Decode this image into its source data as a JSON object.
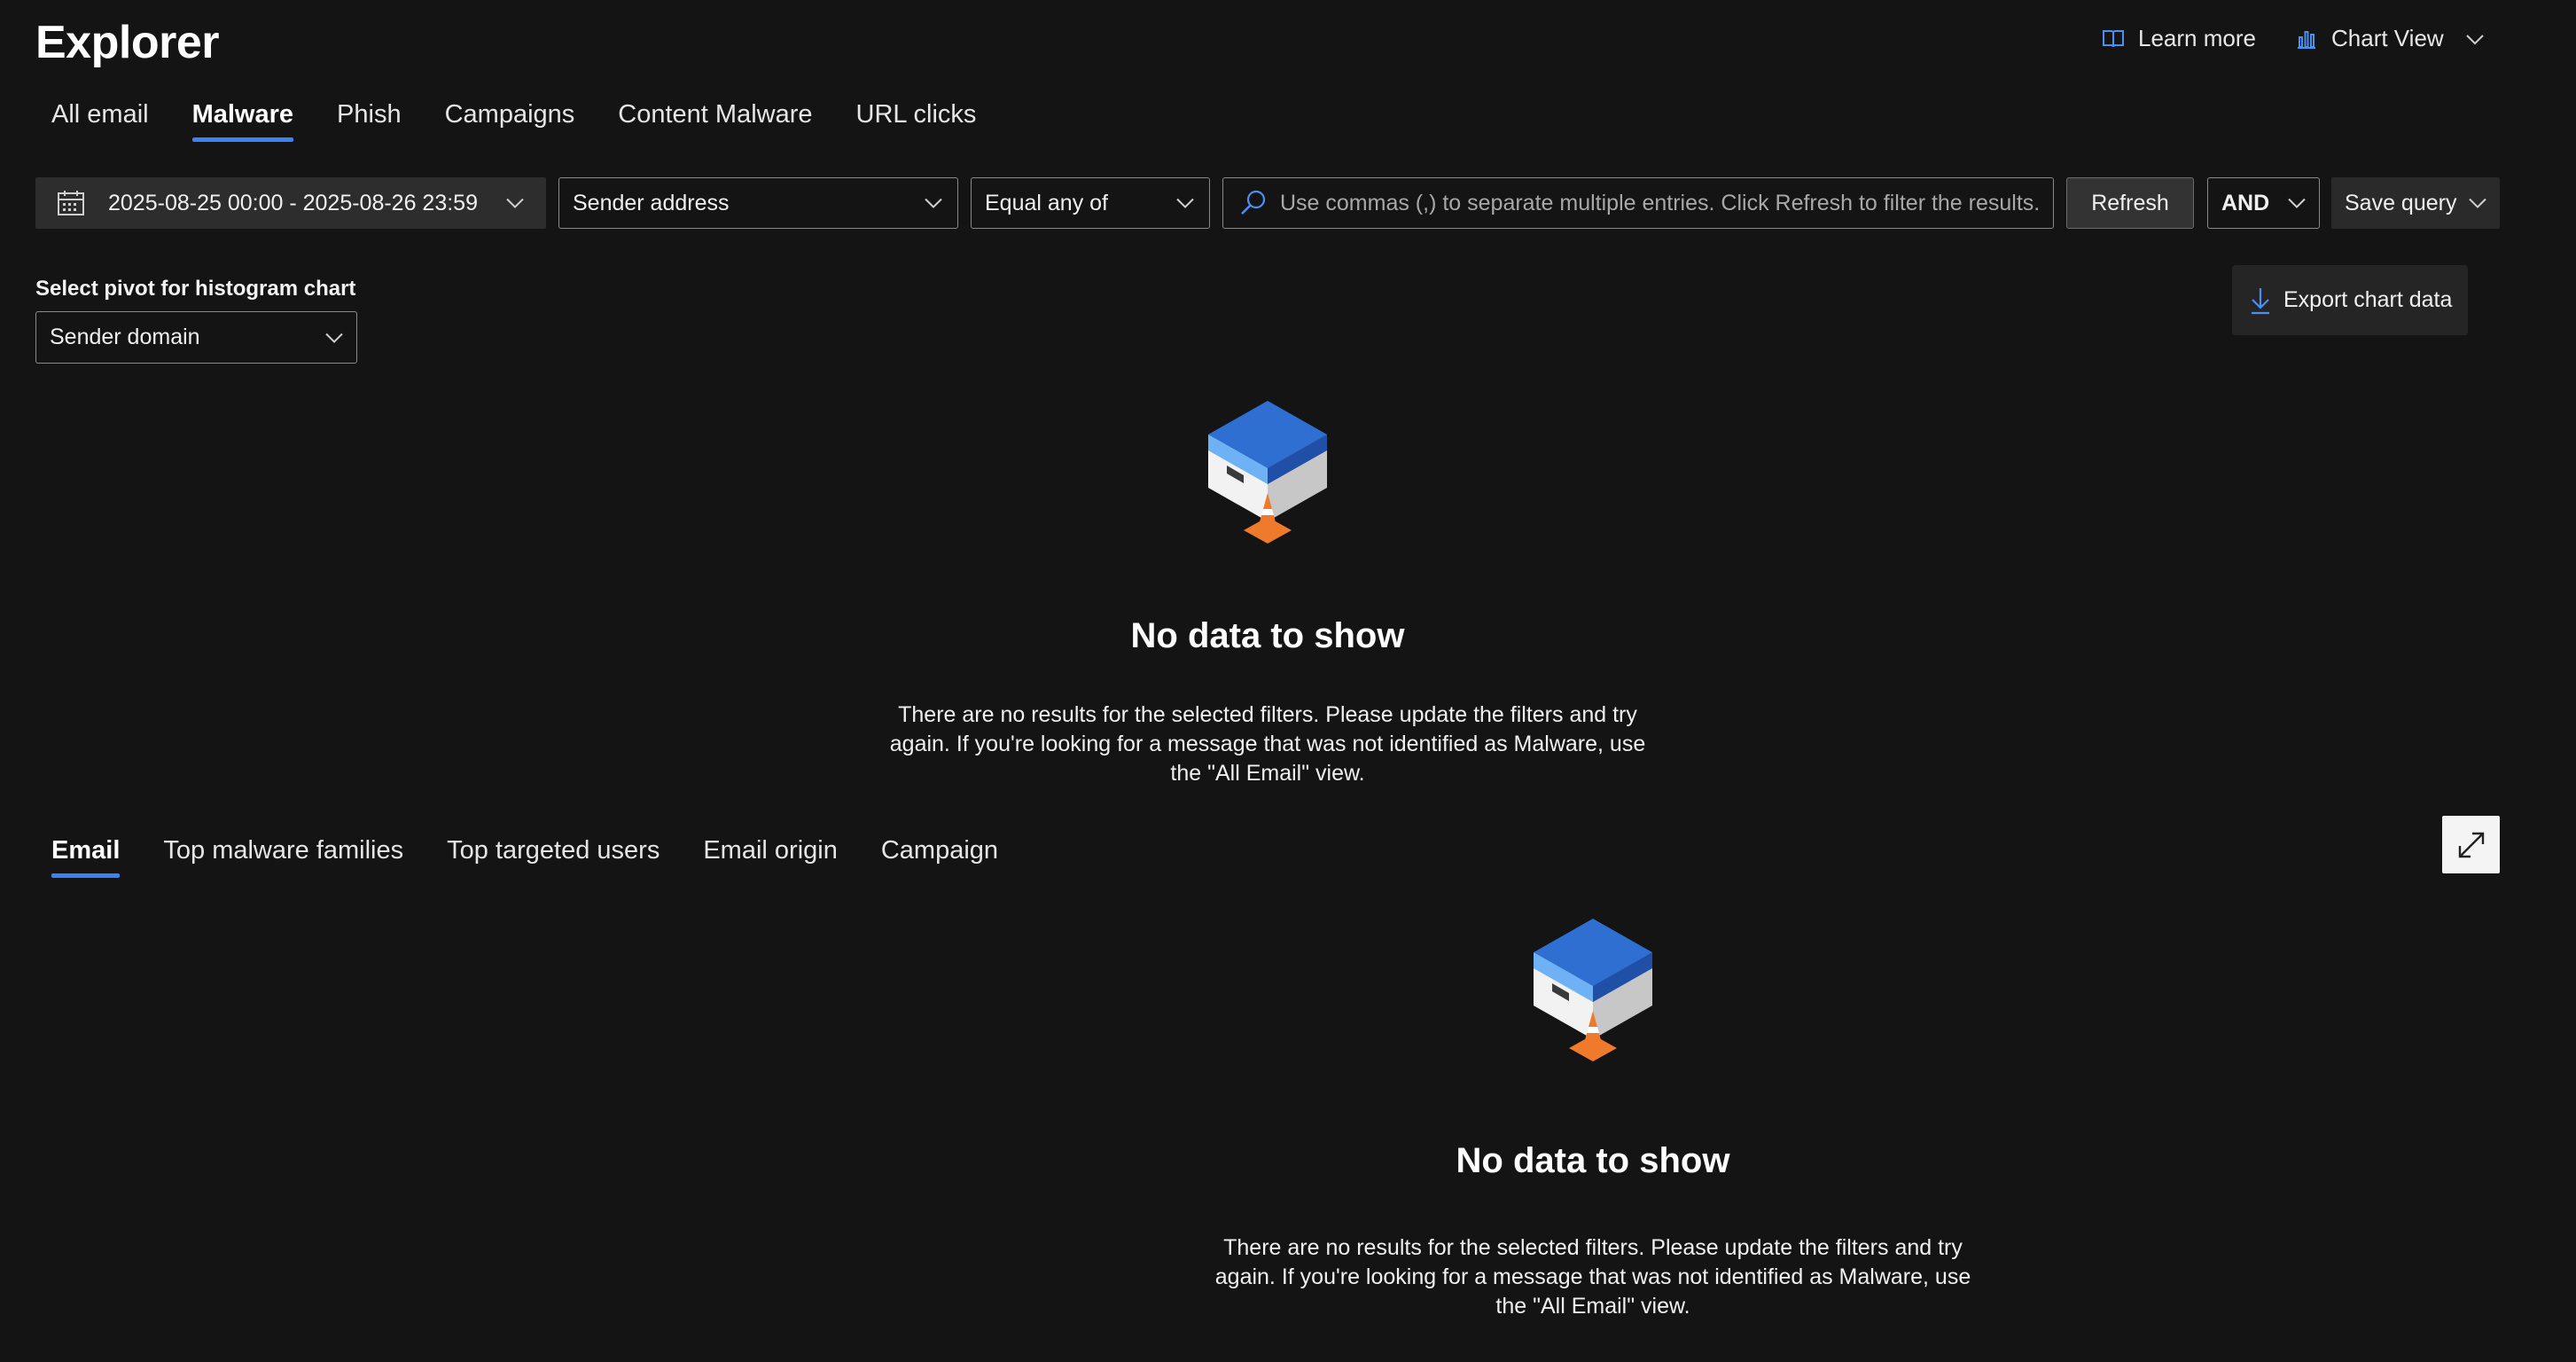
{
  "header": {
    "title": "Explorer",
    "learn_more": "Learn more",
    "view_menu": "Chart View"
  },
  "main_tabs": [
    {
      "label": "All email",
      "active": false
    },
    {
      "label": "Malware",
      "active": true
    },
    {
      "label": "Phish",
      "active": false
    },
    {
      "label": "Campaigns",
      "active": false
    },
    {
      "label": "Content Malware",
      "active": false
    },
    {
      "label": "URL clicks",
      "active": false
    }
  ],
  "filters": {
    "date_range": "2025-08-25 00:00 - 2025-08-26 23:59",
    "field": "Sender address",
    "operator": "Equal any of",
    "search_placeholder": "Use commas (,) to separate multiple entries. Click Refresh to filter the results.",
    "refresh": "Refresh",
    "logic": "AND",
    "save_query": "Save query"
  },
  "pivot": {
    "label": "Select pivot for histogram chart",
    "value": "Sender domain"
  },
  "export_label": "Export chart data",
  "chart_empty": {
    "title": "No data to show",
    "message": "There are no results for the selected filters. Please update the filters and try again. If you're looking for a message that was not identified as Malware, use the \"All Email\" view."
  },
  "detail_tabs": [
    {
      "label": "Email",
      "active": true
    },
    {
      "label": "Top malware families",
      "active": false
    },
    {
      "label": "Top targeted users",
      "active": false
    },
    {
      "label": "Email origin",
      "active": false
    },
    {
      "label": "Campaign",
      "active": false
    }
  ],
  "table_empty": {
    "title": "No data to show",
    "message": "There are no results for the selected filters. Please update the filters and try again. If you're looking for a message that was not identified as Malware, use the \"All Email\" view."
  },
  "colors": {
    "accent": "#3b82f6",
    "background": "#141414",
    "box_blue": "#2f6fd1",
    "cone_orange": "#f07a2b"
  }
}
